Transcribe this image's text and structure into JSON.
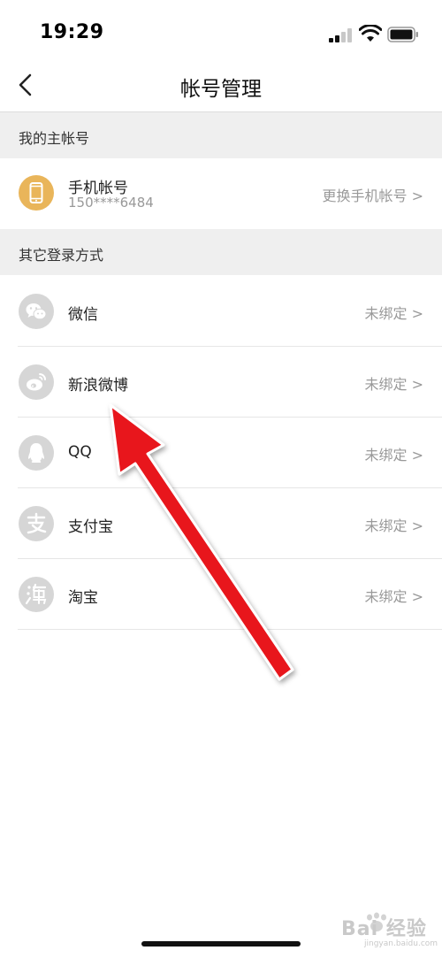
{
  "status_bar": {
    "time": "19:29"
  },
  "nav": {
    "title": "帐号管理"
  },
  "sections": {
    "primary_header": "我的主帐号",
    "other_header": "其它登录方式"
  },
  "primary_account": {
    "title": "手机帐号",
    "number": "150****6484",
    "action": "更换手机帐号 >"
  },
  "login_methods": [
    {
      "name": "微信",
      "status": "未绑定 >",
      "icon": "wechat-icon"
    },
    {
      "name": "新浪微博",
      "status": "未绑定 >",
      "icon": "weibo-icon"
    },
    {
      "name": "QQ",
      "status": "未绑定 >",
      "icon": "qq-icon"
    },
    {
      "name": "支付宝",
      "status": "未绑定 >",
      "icon": "alipay-icon"
    },
    {
      "name": "淘宝",
      "status": "未绑定 >",
      "icon": "taobao-icon"
    }
  ],
  "annotation": {
    "arrow_color": "#e8141b"
  },
  "watermark": {
    "brand": "Bai 经验",
    "url": "jingyan.baidu.com"
  },
  "colors": {
    "phone_icon": "#e9b55a",
    "icon_gray": "#d6d6d6",
    "section_bg": "#efefef"
  }
}
